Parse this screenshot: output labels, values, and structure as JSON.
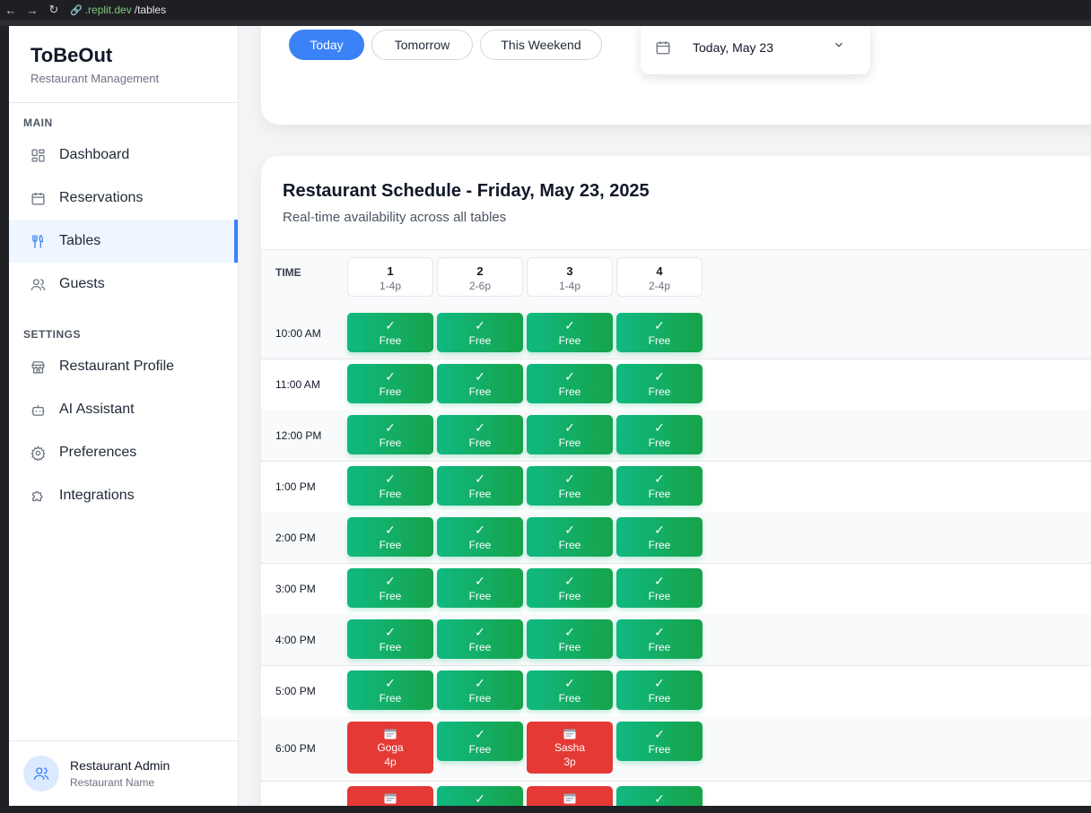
{
  "browser": {
    "back_icon": "arrow-left-icon",
    "url_domain": ".replit.dev",
    "url_path": "/tables"
  },
  "sidebar": {
    "brand_title": "ToBeOut",
    "brand_subtitle": "Restaurant Management",
    "main_label": "MAIN",
    "settings_label": "SETTINGS",
    "main_items": [
      {
        "label": "Dashboard",
        "icon": "grid-icon"
      },
      {
        "label": "Reservations",
        "icon": "calendar-icon"
      },
      {
        "label": "Tables",
        "icon": "utensils-icon",
        "active": true
      },
      {
        "label": "Guests",
        "icon": "users-icon"
      }
    ],
    "settings_items": [
      {
        "label": "Restaurant Profile",
        "icon": "store-icon"
      },
      {
        "label": "AI Assistant",
        "icon": "bot-icon"
      },
      {
        "label": "Preferences",
        "icon": "gear-icon"
      },
      {
        "label": "Integrations",
        "icon": "puzzle-icon"
      }
    ],
    "user": {
      "name": "Restaurant Admin",
      "restaurant": "Restaurant Name"
    }
  },
  "filters": {
    "pills": [
      {
        "label": "Today",
        "active": true
      },
      {
        "label": "Tomorrow",
        "active": false
      },
      {
        "label": "This Weekend",
        "active": false
      }
    ],
    "date_value": "Today, May 23"
  },
  "schedule": {
    "title": "Restaurant Schedule - Friday, May 23, 2025",
    "subtitle": "Real-time availability across all tables",
    "time_header": "TIME",
    "tables": [
      {
        "number": "1",
        "capacity": "1-4p"
      },
      {
        "number": "2",
        "capacity": "2-6p"
      },
      {
        "number": "3",
        "capacity": "1-4p"
      },
      {
        "number": "4",
        "capacity": "2-4p"
      }
    ],
    "free_check": "✓",
    "free_label": "Free",
    "rows": [
      {
        "time": "10:00 AM",
        "cells": [
          {
            "status": "free"
          },
          {
            "status": "free"
          },
          {
            "status": "free"
          },
          {
            "status": "free"
          }
        ]
      },
      {
        "time": "11:00 AM",
        "cells": [
          {
            "status": "free"
          },
          {
            "status": "free"
          },
          {
            "status": "free"
          },
          {
            "status": "free"
          }
        ]
      },
      {
        "time": "12:00 PM",
        "cells": [
          {
            "status": "free"
          },
          {
            "status": "free"
          },
          {
            "status": "free"
          },
          {
            "status": "free"
          }
        ]
      },
      {
        "time": "1:00 PM",
        "cells": [
          {
            "status": "free"
          },
          {
            "status": "free"
          },
          {
            "status": "free"
          },
          {
            "status": "free"
          }
        ]
      },
      {
        "time": "2:00 PM",
        "cells": [
          {
            "status": "free"
          },
          {
            "status": "free"
          },
          {
            "status": "free"
          },
          {
            "status": "free"
          }
        ]
      },
      {
        "time": "3:00 PM",
        "cells": [
          {
            "status": "free"
          },
          {
            "status": "free"
          },
          {
            "status": "free"
          },
          {
            "status": "free"
          }
        ]
      },
      {
        "time": "4:00 PM",
        "cells": [
          {
            "status": "free"
          },
          {
            "status": "free"
          },
          {
            "status": "free"
          },
          {
            "status": "free"
          }
        ]
      },
      {
        "time": "5:00 PM",
        "cells": [
          {
            "status": "free"
          },
          {
            "status": "free"
          },
          {
            "status": "free"
          },
          {
            "status": "free"
          }
        ]
      },
      {
        "time": "6:00 PM",
        "cells": [
          {
            "status": "booked",
            "guest": "Goga",
            "size": "4p"
          },
          {
            "status": "free"
          },
          {
            "status": "booked",
            "guest": "Sasha",
            "size": "3p"
          },
          {
            "status": "free"
          }
        ]
      },
      {
        "time": "",
        "cells": [
          {
            "status": "booked",
            "guest": "",
            "size": ""
          },
          {
            "status": "free"
          },
          {
            "status": "booked",
            "guest": "",
            "size": ""
          },
          {
            "status": "free"
          }
        ]
      }
    ]
  },
  "colors": {
    "accent": "#3b82f6",
    "free": "#10b981",
    "booked": "#e53935"
  }
}
